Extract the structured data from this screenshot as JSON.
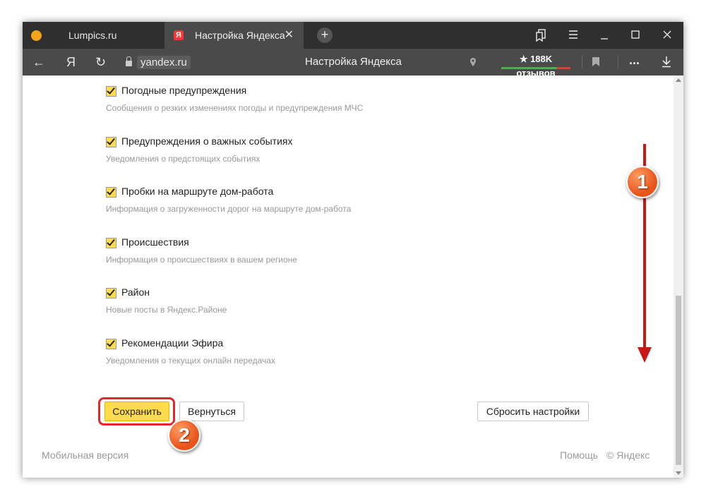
{
  "tabs": [
    {
      "label": "Lumpics.ru"
    },
    {
      "label": "Настройка Яндекса",
      "favicon_letter": "Я"
    }
  ],
  "addressbar": {
    "back_icon": "←",
    "yandex_icon": "Я",
    "reload_icon": "↻",
    "domain": "yandex.ru",
    "page_title": "Настройка Яндекса",
    "reviews": "★ 188K отзывов",
    "more_icon": "...",
    "download_icon": "⤓"
  },
  "options": [
    {
      "title": "Погодные предупреждения",
      "desc": "Сообщения о резких изменениях погоды и предупреждения МЧС",
      "checked": true
    },
    {
      "title": "Предупреждения о важных событиях",
      "desc": "Уведомления о предстоящих событиях",
      "checked": true
    },
    {
      "title": "Пробки на маршруте дом-работа",
      "desc": "Информация о загруженности дорог на маршруте дом-работа",
      "checked": true
    },
    {
      "title": "Происшествия",
      "desc": "Информация о происшествиях в вашем регионе",
      "checked": true
    },
    {
      "title": "Район",
      "desc": "Новые посты в Яндекс.Районе",
      "checked": true
    },
    {
      "title": "Рекомендации Эфира",
      "desc": "Уведомления о текущих онлайн передачах",
      "checked": true
    }
  ],
  "buttons": {
    "save": "Сохранить",
    "back": "Вернуться",
    "reset": "Сбросить настройки"
  },
  "footer": {
    "mobile": "Мобильная версия",
    "help": "Помощь",
    "copyright": "© Яндекс"
  },
  "annotations": {
    "step1": "1",
    "step2": "2"
  },
  "colors": {
    "accent_yellow": "#ffdb4d",
    "annotation_red": "#e3262c"
  }
}
